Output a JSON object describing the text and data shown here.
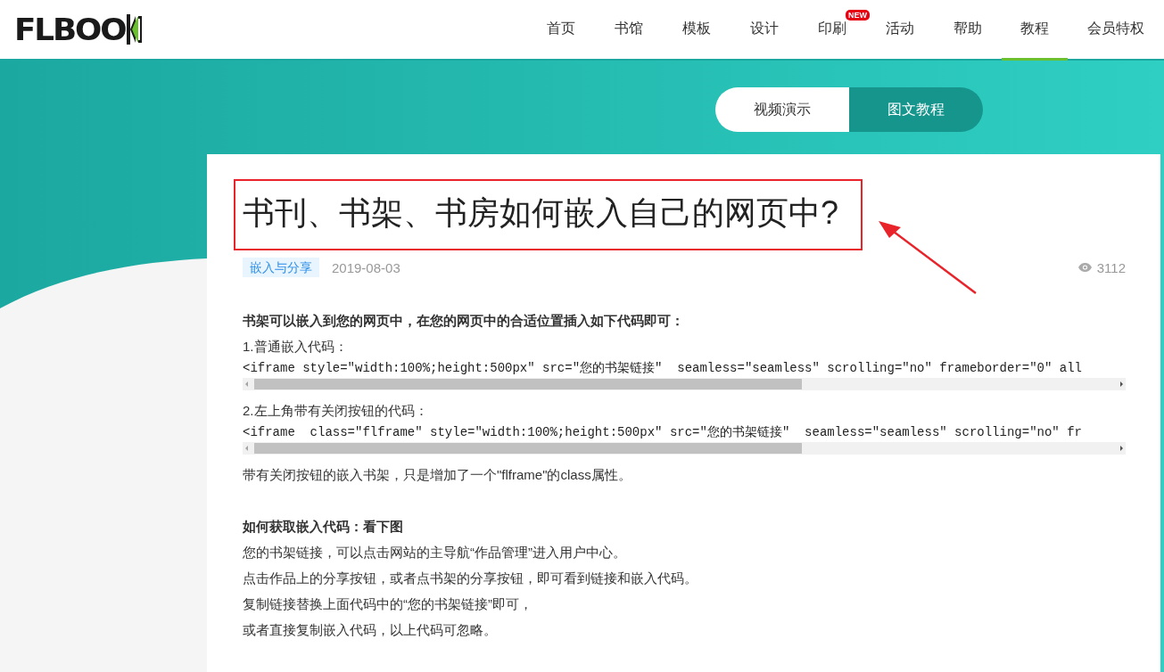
{
  "logo": {
    "text": "FLBOO"
  },
  "nav": [
    {
      "label": "首页",
      "selected": false
    },
    {
      "label": "书馆",
      "selected": false
    },
    {
      "label": "模板",
      "selected": false
    },
    {
      "label": "设计",
      "selected": false
    },
    {
      "label": "印刷",
      "selected": false,
      "badge": "NEW"
    },
    {
      "label": "活动",
      "selected": false
    },
    {
      "label": "帮助",
      "selected": false
    },
    {
      "label": "教程",
      "selected": true
    },
    {
      "label": "会员特权",
      "selected": false
    }
  ],
  "view_toggle": [
    {
      "label": "视频演示",
      "selected": false
    },
    {
      "label": "图文教程",
      "selected": true
    }
  ],
  "article": {
    "title": "书刊、书架、书房如何嵌入自己的网页中?",
    "tag": "嵌入与分享",
    "date": "2019-08-03",
    "views": "3112",
    "body": [
      {
        "kind": "heading",
        "text": "书架可以嵌入到您的网页中，在您的网页中的合适位置插入如下代码即可："
      },
      {
        "kind": "text",
        "text": "1.普通嵌入代码："
      },
      {
        "kind": "code",
        "text": "<iframe style=\"width:100%;height:500px\" src=\"您的书架链接\"  seamless=\"seamless\" scrolling=\"no\" frameborder=\"0\" all"
      },
      {
        "kind": "text",
        "text": "2.左上角带有关闭按钮的代码："
      },
      {
        "kind": "code",
        "text": "<iframe  class=\"flframe\" style=\"width:100%;height:500px\" src=\"您的书架链接\"  seamless=\"seamless\" scrolling=\"no\" fr"
      },
      {
        "kind": "text",
        "text": "带有关闭按钮的嵌入书架，只是增加了一个\"flframe\"的class属性。"
      },
      {
        "kind": "gap"
      },
      {
        "kind": "heading",
        "text": "如何获取嵌入代码：看下图"
      },
      {
        "kind": "text",
        "text": "您的书架链接，可以点击网站的主导航“作品管理”进入用户中心。"
      },
      {
        "kind": "text",
        "text": "点击作品上的分享按钮，或者点书架的分享按钮，即可看到链接和嵌入代码。"
      },
      {
        "kind": "text",
        "text": "复制链接替换上面代码中的“您的书架链接”即可，"
      },
      {
        "kind": "text",
        "text": "或者直接复制嵌入代码，以上代码可忽略。"
      }
    ]
  }
}
